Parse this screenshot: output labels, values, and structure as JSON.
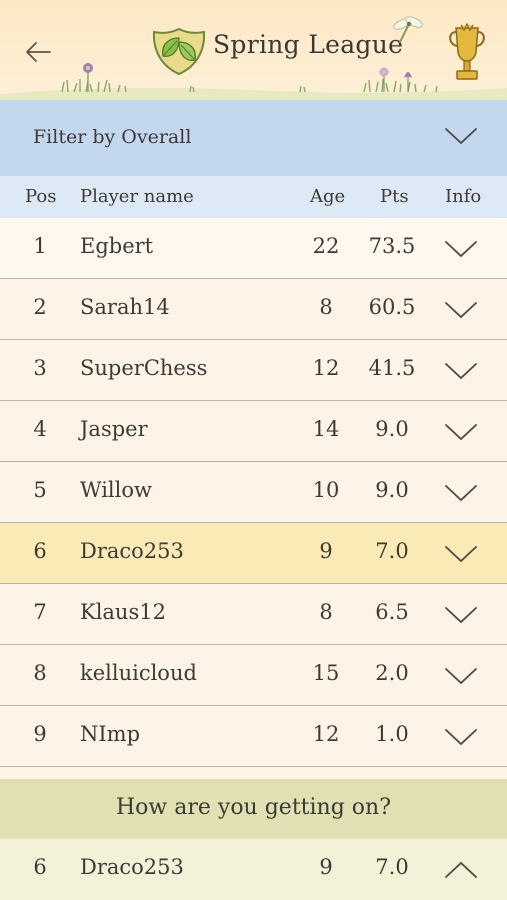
{
  "header": {
    "title": "Spring League",
    "back_icon": "arrow-left-icon",
    "logo_icon": "leaf-shield-icon",
    "trophy_icon": "trophy-icon"
  },
  "filter": {
    "label": "Filter by Overall",
    "icon": "chevron-down-icon"
  },
  "columns": {
    "pos": "Pos",
    "name": "Player name",
    "age": "Age",
    "pts": "Pts",
    "info": "Info"
  },
  "players": [
    {
      "pos": "1",
      "name": "Egbert",
      "age": "22",
      "pts": "73.5"
    },
    {
      "pos": "2",
      "name": "Sarah14",
      "age": "8",
      "pts": "60.5"
    },
    {
      "pos": "3",
      "name": "SuperChess",
      "age": "12",
      "pts": "41.5"
    },
    {
      "pos": "4",
      "name": "Jasper",
      "age": "14",
      "pts": "9.0"
    },
    {
      "pos": "5",
      "name": "Willow",
      "age": "10",
      "pts": "9.0"
    },
    {
      "pos": "6",
      "name": "Draco253",
      "age": "9",
      "pts": "7.0",
      "highlight": true
    },
    {
      "pos": "7",
      "name": "Klaus12",
      "age": "8",
      "pts": "6.5"
    },
    {
      "pos": "8",
      "name": "kelluicloud",
      "age": "15",
      "pts": "2.0"
    },
    {
      "pos": "9",
      "name": "NImp",
      "age": "12",
      "pts": "1.0"
    }
  ],
  "prompt": {
    "text": "How are you getting on?"
  },
  "self": {
    "pos": "6",
    "name": "Draco253",
    "age": "9",
    "pts": "7.0",
    "icon": "chevron-up-icon"
  },
  "colors": {
    "header_bg": "#fde8c4",
    "filter_bg": "#c3d8ee",
    "col_head_bg": "#dde9f5",
    "row_bg": "#fdf3e6",
    "highlight_bg": "#faeab6",
    "prompt_bg": "#e0e0b3",
    "self_bg": "#f3f2d9",
    "text": "#3d3a35"
  }
}
